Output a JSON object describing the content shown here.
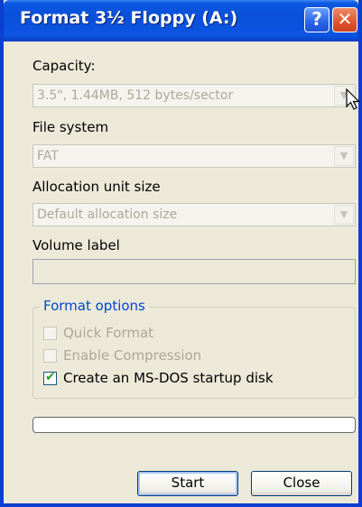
{
  "window": {
    "title": "Format 3½ Floppy (A:)",
    "help_glyph": "?",
    "close_glyph": "✕"
  },
  "capacity": {
    "label": "Capacity:",
    "value": "3.5\",  1.44MB, 512 bytes/sector"
  },
  "file_system": {
    "label": "File system",
    "value": "FAT"
  },
  "allocation": {
    "label": "Allocation unit size",
    "value": "Default allocation size"
  },
  "volume": {
    "label": "Volume label",
    "value": ""
  },
  "options": {
    "legend": "Format options",
    "items": [
      {
        "label": "Quick Format",
        "checked": false,
        "enabled": false
      },
      {
        "label": "Enable Compression",
        "checked": false,
        "enabled": false
      },
      {
        "label": "Create an MS-DOS startup disk",
        "checked": true,
        "enabled": true
      }
    ],
    "check_glyph": "✔"
  },
  "progress": {
    "value": 0
  },
  "buttons": {
    "start": "Start",
    "close": "Close"
  },
  "dropdown_glyph": "▼",
  "colors": {
    "titlebar": "#0a4fd8",
    "legend": "#0046d5",
    "dialog_bg": "#ece9d8"
  }
}
